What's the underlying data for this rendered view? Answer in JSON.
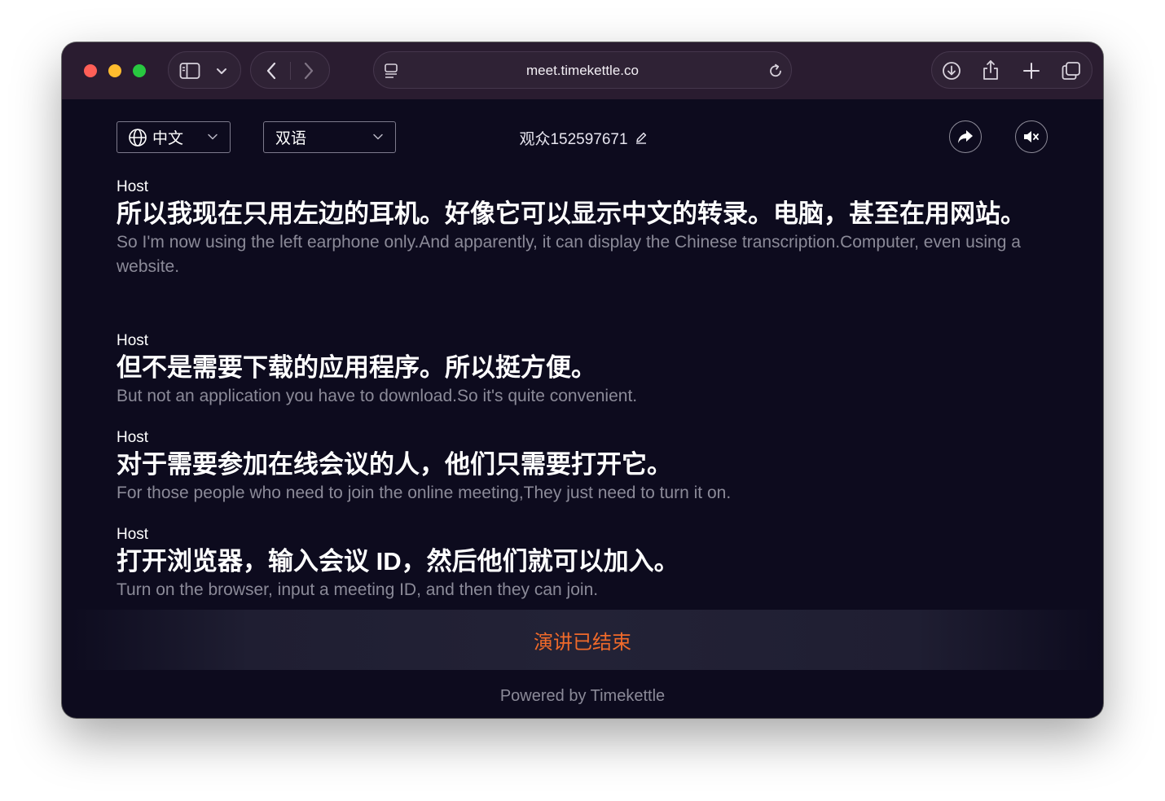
{
  "browser": {
    "url": "meet.timekettle.co"
  },
  "toolbar": {
    "language_select": "中文",
    "mode_select": "双语",
    "viewer_name": "观众152597671"
  },
  "transcript": [
    {
      "speaker": "Host",
      "source": "所以我现在只用左边的耳机。好像它可以显示中文的转录。电脑，甚至在用网站。",
      "translation": "So I'm now using the left earphone only.And apparently, it can display the Chinese transcription.Computer, even using a website."
    },
    {
      "speaker": "Host",
      "source": "但不是需要下载的应用程序。所以挺方便。",
      "translation": "But not an application you have to download.So it's quite convenient."
    },
    {
      "speaker": "Host",
      "source": "对于需要参加在线会议的人，他们只需要打开它。",
      "translation": "For those people who need to join the online meeting,They just need to turn it on."
    },
    {
      "speaker": "Host",
      "source": "打开浏览器，输入会议 ID，然后他们就可以加入。",
      "translation": "Turn on the browser, input a meeting ID, and then they can join."
    }
  ],
  "status": {
    "ended": "演讲已结束"
  },
  "footer": {
    "powered_by": "Powered by Timekettle"
  },
  "colors": {
    "background": "#0d0b1e",
    "titlebar": "#2a1c30",
    "ended_accent": "#f06a2a",
    "translation_text": "#8b8a98"
  }
}
